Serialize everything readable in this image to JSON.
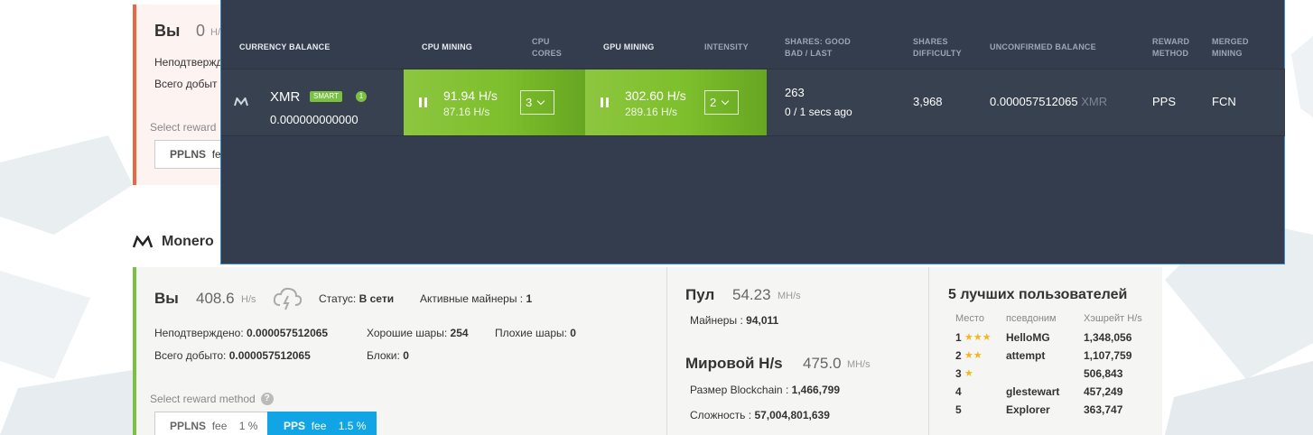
{
  "colors": {
    "accent_orange": "#e8683f",
    "accent_green": "#7ac142",
    "pps_blue": "#11a5e6",
    "panel_bg": "#343d4d",
    "panel_border": "#3b88c4"
  },
  "top_card": {
    "you_label": "Вы",
    "you_value": "0",
    "you_unit": "H/",
    "unconfirmed_label": "Неподтвержд",
    "mined_label": "Всего добыт",
    "select_reward": "Select reward",
    "pplns_label": "PPLNS",
    "fee_label": "fe"
  },
  "monero_section": {
    "title": "Monero",
    "icon": "monero-logo-icon",
    "you_label": "Вы",
    "you_value": "408.6",
    "you_unit": "H/s",
    "status_label": "Статус:",
    "status_value": "В сети",
    "active_miners_label": "Активные майнеры",
    "active_miners_value": "1",
    "unconfirmed_label": "Неподтверждено:",
    "unconfirmed_value": "0.000057512065",
    "good_shares_label": "Хорошие шары:",
    "good_shares_value": "254",
    "bad_shares_label": "Плохие шары:",
    "bad_shares_value": "0",
    "total_mined_label": "Всего добыто:",
    "total_mined_value": "0.000057512065",
    "blocks_label": "Блоки:",
    "blocks_value": "0",
    "select_reward": "Select reward method",
    "help_mark": "?",
    "pplns": {
      "name": "PPLNS",
      "fee_word": "fee",
      "fee": "1 %"
    },
    "pps": {
      "name": "PPS",
      "fee_word": "fee",
      "fee": "1.5 %"
    },
    "pool_label": "Пул",
    "pool_value": "54.23",
    "pool_unit": "MH/s",
    "miners_label": "Майнеры",
    "miners_value": "94,011",
    "world_label": "Мировой H/s",
    "world_value": "475.0",
    "world_unit": "MH/s",
    "blockchain_label": "Размер Blockchain",
    "blockchain_value": "1,466,799",
    "difficulty_label": "Сложность",
    "difficulty_value": "57,004,801,639",
    "colon": ":"
  },
  "top_users": {
    "title": "5 лучших пользователей",
    "headers": [
      "Место",
      "псевдоним",
      "Хэшрейт H/s"
    ],
    "rows": [
      {
        "place": "1",
        "stars": "★★★",
        "name": "HelloMG",
        "rate": "1,348,056"
      },
      {
        "place": "2",
        "stars": "★★",
        "name": "attempt",
        "rate": "1,107,759"
      },
      {
        "place": "3",
        "stars": "★",
        "name": "",
        "rate": "506,843"
      },
      {
        "place": "4",
        "stars": "",
        "name": "glestewart",
        "rate": "457,249"
      },
      {
        "place": "5",
        "stars": "",
        "name": "Explorer",
        "rate": "363,747"
      }
    ]
  },
  "panel": {
    "headers": {
      "currency_balance": "CURRENCY BALANCE",
      "cpu_mining": "CPU MINING",
      "cpu_cores_1": "CPU",
      "cpu_cores_2": "CORES",
      "gpu_mining": "GPU MINING",
      "intensity": "INTENSITY",
      "shares_1": "SHARES: GOOD",
      "shares_2": "BAD / LAST",
      "difficulty_1": "SHARES",
      "difficulty_2": "DIFFICULTY",
      "unconfirmed": "UNCONFIRMED BALANCE",
      "reward_1": "REWARD",
      "reward_2": "METHOD",
      "merged_1": "MERGED",
      "merged_2": "MINING"
    },
    "row": {
      "coin": "XMR",
      "smart_badge": "SMART",
      "count_badge": "1",
      "balance": "0.000000000000",
      "cpu_rate": "91.94 H/s",
      "cpu_avg": "87.16 H/s",
      "cpu_cores": "3",
      "gpu_rate": "302.60 H/s",
      "gpu_avg": "289.16 H/s",
      "intensity": "2",
      "shares_good": "263",
      "shares_bad_last": "0 / 1 secs ago",
      "difficulty": "3,968",
      "unconfirmed": "0.000057512065",
      "unconfirmed_unit": "XMR",
      "reward_method": "PPS",
      "merged_mining": "FCN"
    }
  }
}
